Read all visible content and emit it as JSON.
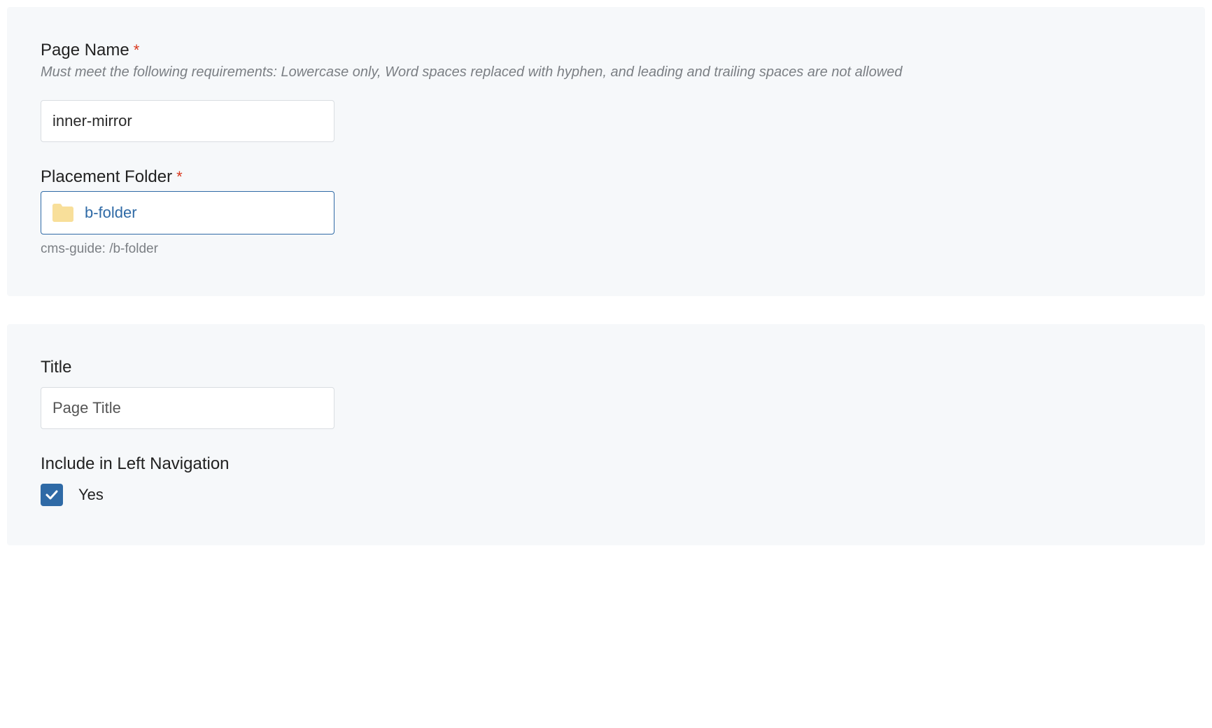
{
  "section1": {
    "pageName": {
      "label": "Page Name",
      "required": "*",
      "help": "Must meet the following requirements: Lowercase only, Word spaces replaced with hyphen, and leading and trailing spaces are not allowed",
      "value": "inner-mirror"
    },
    "placementFolder": {
      "label": "Placement Folder",
      "required": "*",
      "selected": "b-folder",
      "pathHint": "cms-guide: /b-folder"
    }
  },
  "section2": {
    "title": {
      "label": "Title",
      "placeholder": "Page Title"
    },
    "includeNav": {
      "label": "Include in Left Navigation",
      "optionLabel": "Yes",
      "checked": true
    }
  }
}
